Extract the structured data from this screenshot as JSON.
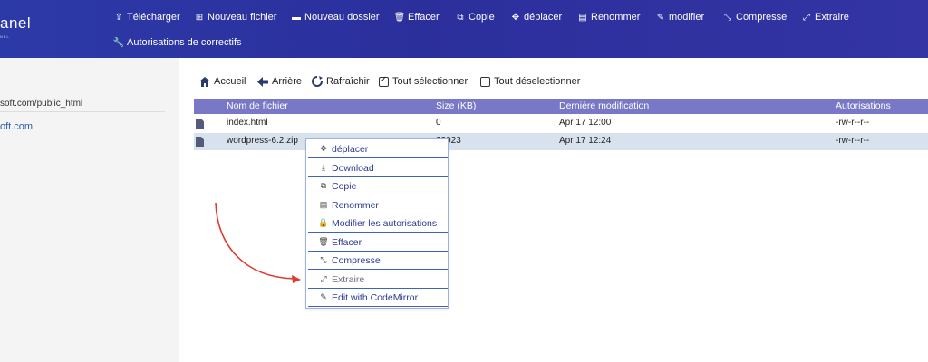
{
  "header": {
    "logo_text": "anel",
    "logo_sub": "NEL",
    "toolbar": [
      {
        "label": "Télécharger",
        "icon": "upload-icon",
        "glyph": "⇪"
      },
      {
        "label": "Nouveau fichier",
        "icon": "plus-square-icon",
        "glyph": "⊞"
      },
      {
        "label": "Nouveau dossier",
        "icon": "folder-icon",
        "glyph": "▬"
      },
      {
        "label": "Effacer",
        "icon": "trash-icon",
        "glyph": "🗑"
      },
      {
        "label": "Copie",
        "icon": "copy-icon",
        "glyph": "⧉"
      },
      {
        "label": "déplacer",
        "icon": "move-icon",
        "glyph": "✥"
      },
      {
        "label": "Renommer",
        "icon": "rename-icon",
        "glyph": "▤"
      },
      {
        "label": "modifier",
        "icon": "edit-icon",
        "glyph": "✎"
      },
      {
        "label": "Compresse",
        "icon": "compress-icon",
        "glyph": "⤡"
      },
      {
        "label": "Extraire",
        "icon": "expand-icon",
        "glyph": "⤢"
      },
      {
        "label": "Autorisations de correctifs",
        "icon": "wrench-icon",
        "glyph": "🔧"
      }
    ]
  },
  "sidebar": {
    "path": "soft.com/public_html",
    "domain": "oft.com"
  },
  "nav": {
    "home": "Accueil",
    "back": "Arrière",
    "refresh": "Rafraîchir",
    "select_all": "Tout sélectionner",
    "deselect_all": "Tout déselectionner"
  },
  "table": {
    "headers": [
      "Nom de fichier",
      "Size (KB)",
      "Dernière modification",
      "Autorisations"
    ],
    "rows": [
      {
        "name": "index.html",
        "size": "0",
        "modified": "Apr 17 12:00",
        "perms": "-rw-r--r--"
      },
      {
        "name": "wordpress-6.2.zip",
        "size": "23923",
        "modified": "Apr 17 12:24",
        "perms": "-rw-r--r--"
      }
    ]
  },
  "context_menu": {
    "items": [
      {
        "label": "déplacer",
        "icon": "move-icon",
        "glyph": "✥"
      },
      {
        "label": "Download",
        "icon": "download-icon",
        "glyph": "⤓"
      },
      {
        "label": "Copie",
        "icon": "copy-icon",
        "glyph": "⧉"
      },
      {
        "label": "Renommer",
        "icon": "rename-icon",
        "glyph": "▤"
      },
      {
        "label": "Modifier les autorisations",
        "icon": "lock-icon",
        "glyph": "🔒"
      },
      {
        "label": "Effacer",
        "icon": "trash-icon",
        "glyph": "🗑"
      },
      {
        "label": "Compresse",
        "icon": "compress-icon",
        "glyph": "⤡"
      },
      {
        "label": "Extraire",
        "icon": "expand-icon",
        "glyph": "⤢"
      },
      {
        "label": "Edit with CodeMirror",
        "icon": "edit-icon",
        "glyph": "✎"
      }
    ]
  },
  "colors": {
    "header": "#2b2f9c",
    "table_header": "#7878c6",
    "selected_row": "#d8e2ef",
    "arrow": "#e03a2e"
  }
}
